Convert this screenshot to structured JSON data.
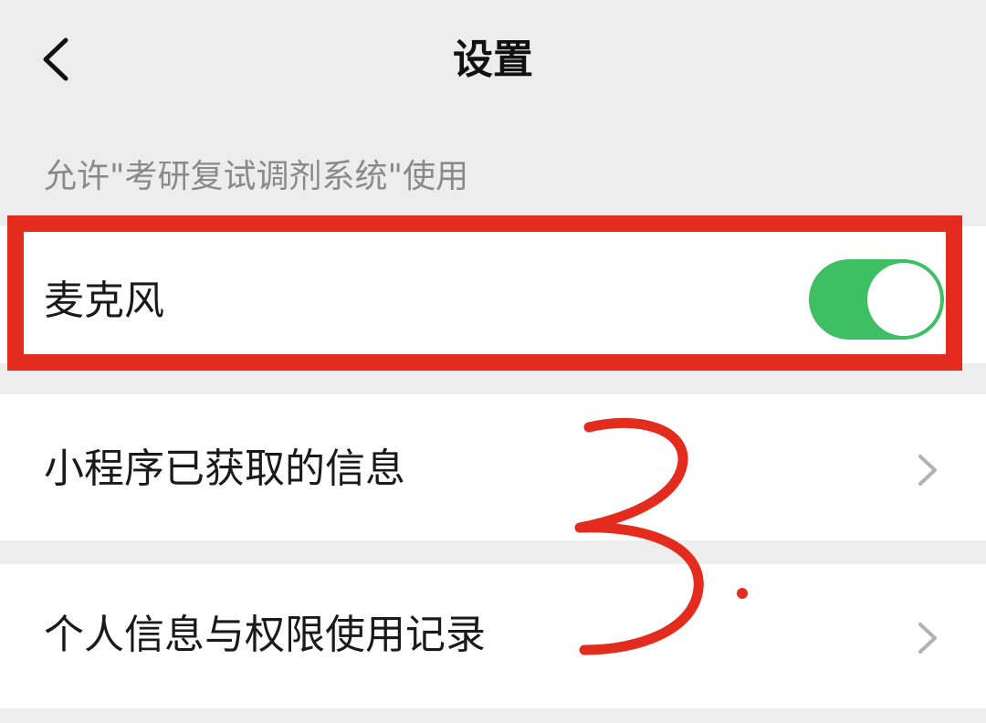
{
  "nav": {
    "title": "设置"
  },
  "section": {
    "caption": "允许\"考研复试调剂系统\"使用"
  },
  "rows": {
    "microphone": {
      "label": "麦克风",
      "toggle_on": true
    },
    "obtained_info": {
      "label": "小程序已获取的信息"
    },
    "privacy_record": {
      "label": "个人信息与权限使用记录"
    }
  },
  "annotation": {
    "handwritten_mark": "3."
  },
  "colors": {
    "background": "#ededed",
    "highlight": "#e32b1e",
    "toggle_on": "#3fbf63",
    "caption_text": "#8a8a8a"
  }
}
